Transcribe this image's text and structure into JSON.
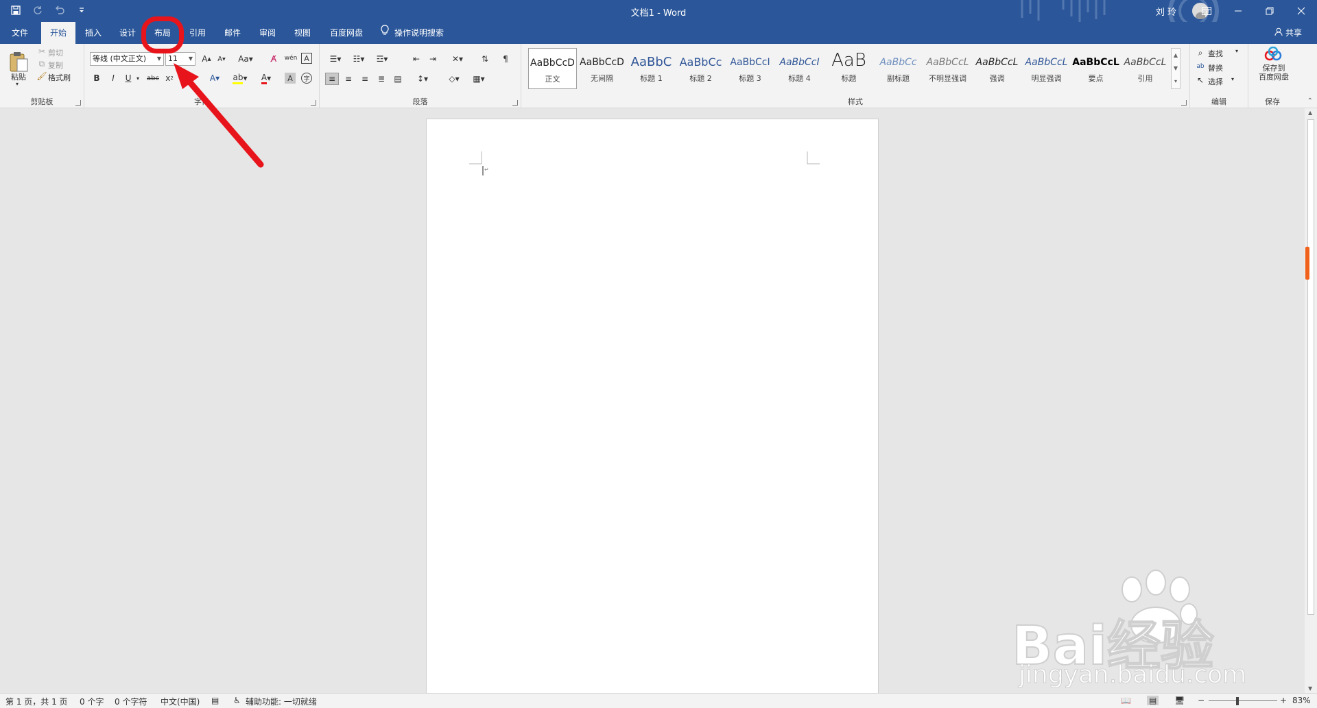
{
  "window": {
    "title": "文档1  -  Word",
    "user": "刘 玲",
    "qat_icons": [
      "save-icon",
      "autosave-icon",
      "undo-icon",
      "customize-icon"
    ],
    "controls": [
      "ribbon-display-icon",
      "minimize-icon",
      "restore-icon",
      "close-icon"
    ]
  },
  "tabs": [
    {
      "label": "文件"
    },
    {
      "label": "开始",
      "active": true
    },
    {
      "label": "插入"
    },
    {
      "label": "设计"
    },
    {
      "label": "布局"
    },
    {
      "label": "引用"
    },
    {
      "label": "邮件"
    },
    {
      "label": "审阅"
    },
    {
      "label": "视图"
    },
    {
      "label": "百度网盘"
    }
  ],
  "tell_me": "操作说明搜索",
  "share": "共享",
  "ribbon": {
    "clipboard": {
      "paste": "粘贴",
      "cut": "剪切",
      "copy": "复制",
      "format_painter": "格式刷",
      "label": "剪贴板"
    },
    "font": {
      "font_name": "等线 (中文正文)",
      "font_size": "11",
      "label": "字体"
    },
    "paragraph": {
      "label": "段落"
    },
    "styles": {
      "label": "样式",
      "items": [
        {
          "sample": "AaBbCcD",
          "name": "正文",
          "color": "#222222"
        },
        {
          "sample": "AaBbCcD",
          "name": "无间隔",
          "color": "#222222"
        },
        {
          "sample": "AaBbC",
          "name": "标题 1",
          "color": "#2f5597"
        },
        {
          "sample": "AaBbCc",
          "name": "标题 2",
          "color": "#2f5597"
        },
        {
          "sample": "AaBbCcI",
          "name": "标题 3",
          "color": "#2f5597"
        },
        {
          "sample": "AaBbCcI",
          "name": "标题 4",
          "color": "#2f5597"
        },
        {
          "sample": "AaB",
          "name": "标题",
          "color": "#222222"
        },
        {
          "sample": "AaBbCc",
          "name": "副标题",
          "color": "#6f8fbf"
        },
        {
          "sample": "AaBbCcL",
          "name": "不明显强调",
          "color": "#777777"
        },
        {
          "sample": "AaBbCcL",
          "name": "强调",
          "color": "#222222"
        },
        {
          "sample": "AaBbCcL",
          "name": "明显强调",
          "color": "#2f5597"
        },
        {
          "sample": "AaBbCcL",
          "name": "要点",
          "color": "#000000"
        },
        {
          "sample": "AaBbCcL",
          "name": "引用",
          "color": "#444444"
        }
      ]
    },
    "editing": {
      "find": "查找",
      "replace": "替换",
      "select": "选择",
      "label": "编辑"
    },
    "save": {
      "button": "保存到\n百度网盘",
      "label": "保存"
    }
  },
  "status": {
    "page": "第 1 页，共 1 页",
    "words": "0 个字",
    "chars": "0 个字符",
    "language": "中文(中国)",
    "accessibility": "辅助功能: 一切就绪",
    "zoom": "83%"
  },
  "watermark": {
    "text": "Bai经验",
    "url": "jingyan.baidu.com"
  },
  "colors": {
    "brand": "#2b579a",
    "annotation": "#e8141b"
  }
}
